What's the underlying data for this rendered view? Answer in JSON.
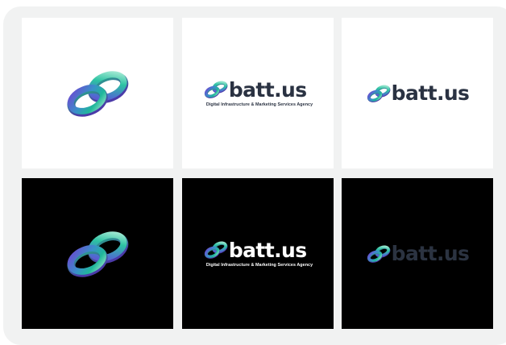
{
  "brand": {
    "name": "batt.us",
    "tagline": "Digital Infrastructure & Marketing Services Agency"
  },
  "colors": {
    "frame_background": "#f1f2f2",
    "light_tile": "#ffffff",
    "dark_tile": "#000000",
    "wordmark_dark": "#2a3242",
    "wordmark_light": "#ffffff",
    "icon_teal": "#1fb79a",
    "icon_purple": "#6a4bd1"
  },
  "tiles": [
    {
      "variant": "icon",
      "background": "light"
    },
    {
      "variant": "full-lockup",
      "background": "light"
    },
    {
      "variant": "wordmark-lockup",
      "background": "light"
    },
    {
      "variant": "icon",
      "background": "dark"
    },
    {
      "variant": "full-lockup",
      "background": "dark"
    },
    {
      "variant": "wordmark-lockup",
      "background": "dark"
    }
  ],
  "icons": {
    "logo_mark": "interlocking-rings-icon"
  }
}
